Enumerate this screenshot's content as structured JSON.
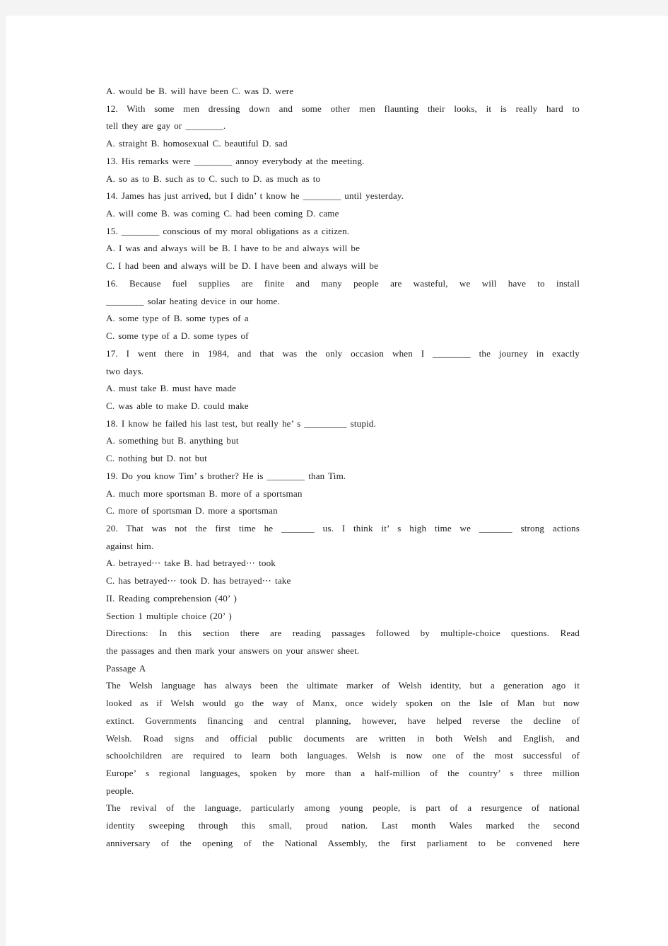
{
  "page": {
    "background_color": "#f4f4f4",
    "sheet_color": "#ffffff",
    "text_color": "#1d1d1d"
  },
  "document": {
    "type": "english-exam-paper",
    "lines": [
      {
        "id": "q11_options",
        "text": "A. would be B. will have been C. was D. were",
        "style": "flush"
      },
      {
        "id": "q12_line1",
        "text": "12. With some men dressing down and some other men flaunting their looks, it is really hard to",
        "style": "just"
      },
      {
        "id": "q12_line2",
        "text": "tell they are gay or ________.",
        "style": "flush"
      },
      {
        "id": "q12_options",
        "text": "A. straight B. homosexual C. beautiful D. sad",
        "style": "flush"
      },
      {
        "id": "q13_stem",
        "text": "13. His remarks were ________ annoy everybody at the meeting.",
        "style": "flush"
      },
      {
        "id": "q13_options",
        "text": "A. so as to B. such as to C. such to D. as much as to",
        "style": "flush"
      },
      {
        "id": "q14_stem",
        "text": "14. James has just arrived, but I didn’ t know he ________ until yesterday.",
        "style": "flush"
      },
      {
        "id": "q14_options",
        "text": "A. will come B. was coming C. had been coming D. came",
        "style": "flush"
      },
      {
        "id": "q15_stem",
        "text": "15. ________ conscious of my moral obligations as a citizen.",
        "style": "flush"
      },
      {
        "id": "q15_opt_ab",
        "text": "A. I was and always will be B. I have to be and always will be",
        "style": "flush"
      },
      {
        "id": "q15_opt_cd",
        "text": "C. I had been and always will be D. I have been and always will be",
        "style": "flush"
      },
      {
        "id": "q16_line1",
        "text": "16. Because fuel supplies are finite and many people are wasteful, we will have to install",
        "style": "just"
      },
      {
        "id": "q16_line2",
        "text": "________ solar heating device in our home.",
        "style": "flush"
      },
      {
        "id": "q16_opt_ab",
        "text": "A. some type of B. some types of a",
        "style": "flush"
      },
      {
        "id": "q16_opt_cd",
        "text": "C. some type of a D. some types of",
        "style": "flush"
      },
      {
        "id": "q17_line1",
        "text": "17. I went there in 1984, and that was the only occasion when I ________ the journey in exactly",
        "style": "just"
      },
      {
        "id": "q17_line2",
        "text": "two days.",
        "style": "flush"
      },
      {
        "id": "q17_opt_ab",
        "text": "A. must take B. must have made",
        "style": "flush"
      },
      {
        "id": "q17_opt_cd",
        "text": "C. was able to make D. could make",
        "style": "flush"
      },
      {
        "id": "q18_stem",
        "text": "18. I know he failed his last test, but really he’ s _________ stupid.",
        "style": "flush"
      },
      {
        "id": "q18_opt_ab",
        "text": "A. something but B. anything but",
        "style": "flush"
      },
      {
        "id": "q18_opt_cd",
        "text": "C. nothing but D. not but",
        "style": "flush"
      },
      {
        "id": "q19_stem",
        "text": "19. Do you know Tim’ s brother? He is ________ than Tim.",
        "style": "flush"
      },
      {
        "id": "q19_opt_ab",
        "text": "A. much more sportsman B. more of a sportsman",
        "style": "flush"
      },
      {
        "id": "q19_opt_cd",
        "text": "C. more of sportsman D. more a sportsman",
        "style": "flush"
      },
      {
        "id": "q20_line1",
        "text": "20. That was not the first time he _______ us. I think it’ s high time we _______ strong actions",
        "style": "just"
      },
      {
        "id": "q20_line2",
        "text": "against him.",
        "style": "flush"
      },
      {
        "id": "q20_opt_ab",
        "text": "A. betrayed⋯ take B. had betrayed⋯ took",
        "style": "flush"
      },
      {
        "id": "q20_opt_cd",
        "text": "C. has betrayed⋯ took D. has betrayed⋯ take",
        "style": "flush"
      },
      {
        "id": "section2_title",
        "text": "II. Reading comprehension (40’ )",
        "style": "flush"
      },
      {
        "id": "section1_heading",
        "text": "Section 1 multiple choice (20’ )",
        "style": "flush"
      },
      {
        "id": "directions_line1",
        "text": "Directions: In this section there are reading passages followed by multiple-choice questions. Read",
        "style": "just"
      },
      {
        "id": "directions_line2",
        "text": "the passages and then mark your answers on your answer sheet.",
        "style": "flush"
      },
      {
        "id": "passage_a_label",
        "text": "Passage A",
        "style": "flush"
      },
      {
        "id": "p1_line1",
        "text": "The Welsh language has always been the ultimate marker of Welsh identity, but a generation ago it",
        "style": "just"
      },
      {
        "id": "p1_line2",
        "text": "looked as if Welsh would go the way of Manx, once widely spoken on the Isle of Man but now",
        "style": "just"
      },
      {
        "id": "p1_line3",
        "text": "extinct. Governments financing and central planning, however, have helped reverse the decline of",
        "style": "just"
      },
      {
        "id": "p1_line4",
        "text": "Welsh. Road signs and official public documents are written in both Welsh and English, and",
        "style": "just"
      },
      {
        "id": "p1_line5",
        "text": "schoolchildren are required to learn both languages. Welsh is now one of the most successful of",
        "style": "just"
      },
      {
        "id": "p1_line6",
        "text": "Europe’ s regional languages, spoken by more than a half-million of the country’ s three million",
        "style": "just"
      },
      {
        "id": "p1_line7",
        "text": "people.",
        "style": "flush"
      },
      {
        "id": "p2_line1",
        "text": "The revival of the language, particularly among young people, is part of a resurgence of national",
        "style": "just"
      },
      {
        "id": "p2_line2",
        "text": "identity sweeping through this small, proud nation. Last month Wales marked the second",
        "style": "just"
      },
      {
        "id": "p2_line3",
        "text": "anniversary of the opening of the National Assembly, the first parliament to be convened here",
        "style": "just"
      }
    ]
  }
}
